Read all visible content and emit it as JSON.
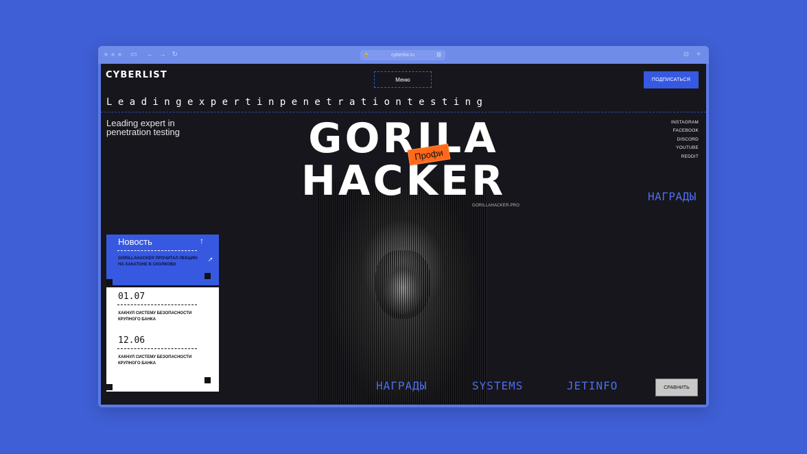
{
  "browser": {
    "url": "cyberlist.ru",
    "back_icon": "←",
    "forward_icon": "→",
    "reload_icon": "↻",
    "download_icon": "⊙",
    "new_tab_icon": "+"
  },
  "header": {
    "logo": "CYBERLIST",
    "menu_label": "Меню",
    "subscribe_label": "ПОДПИСАТЬСЯ"
  },
  "marquee": "L e a d i n g   e x p e r t   i n p e n e t r a t i o n   t e s t i n g",
  "tagline": "Leading expert in penetration testing",
  "social": [
    "INSTAGRAM",
    "FACEBOOK",
    "DISCORD",
    "YOUTUBE",
    "REDDIT"
  ],
  "hero": {
    "title_line1": "GORILA",
    "title_line2": "HACKER",
    "badge": "Профи",
    "subdomain": "GORILLAHACKER.PRO",
    "awards_side": "НАГРАДЫ"
  },
  "news": {
    "heading": "Новость",
    "arrow": "↑",
    "text": "GORILLAHACKER ПРОЧИТАЛ ЛЕКЦИЮ НА ХАКАТОНЕ В СКОЛКОВО"
  },
  "events": [
    {
      "date": "01.07",
      "text": "ХАКНУЛ СИСТЕМУ БЕЗОПАСНОСТИ КРУПНОГО БАНКА"
    },
    {
      "date": "12.06",
      "text": "ХАКНУЛ СИСТЕМУ БЕЗОПАСНОСТИ КРУПНОГО БАНКА"
    }
  ],
  "bottom_links": [
    "НАГРАДЫ",
    "SYSTEMS",
    "JETINFO"
  ],
  "compare_label": "СРАВНИТЬ",
  "colors": {
    "background": "#3f5fd6",
    "site_bg": "#17161c",
    "accent_blue": "#3759e2",
    "badge_orange": "#ff6a1a"
  }
}
